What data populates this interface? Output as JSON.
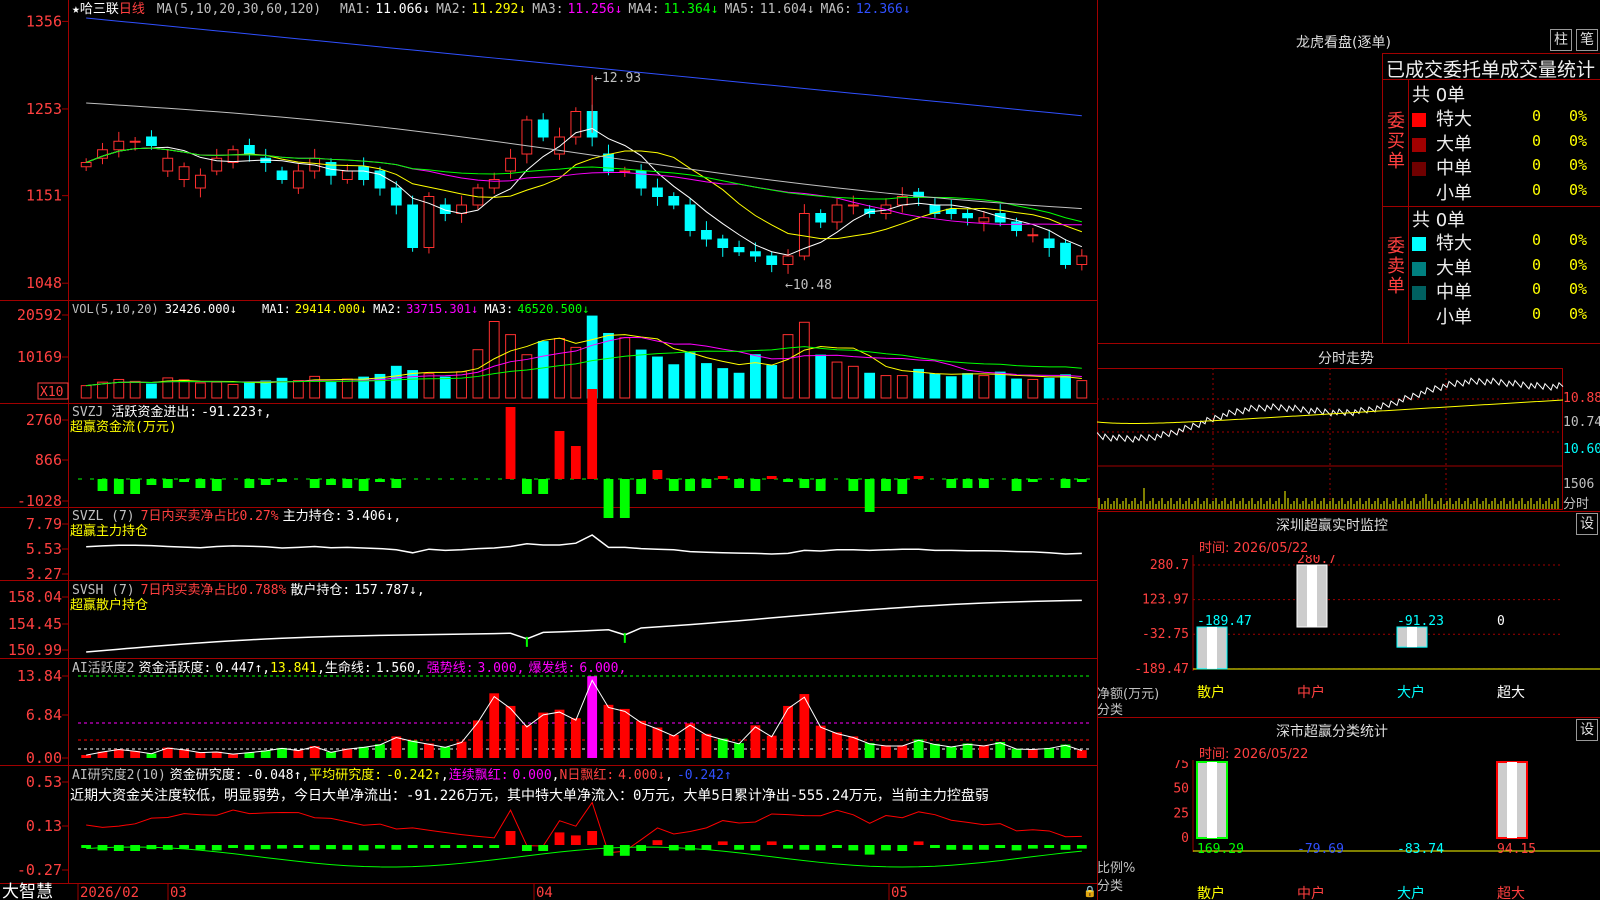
{
  "app": {
    "brand": "大智慧"
  },
  "main": {
    "star_icon": "star-icon",
    "stock_name": "哈三联",
    "period": "日线",
    "ma_label": "MA(5,10,20,30,60,120)",
    "ma": [
      {
        "label": "MA1:",
        "value": "11.066↓",
        "color": "#ffffff"
      },
      {
        "label": "MA2:",
        "value": "11.292↓",
        "color": "#ffff00"
      },
      {
        "label": "MA3:",
        "value": "11.256↓",
        "color": "#ff00ff"
      },
      {
        "label": "MA4:",
        "value": "11.364↓",
        "color": "#00ff00"
      },
      {
        "label": "MA5:",
        "value": "11.604↓",
        "color": "#c0c0c0"
      },
      {
        "label": "MA6:",
        "value": "12.366↓",
        "color": "#3050ff"
      }
    ],
    "y_ticks": [
      "1356",
      "1253",
      "1151",
      "1048"
    ],
    "high_label": "12.93",
    "low_label": "10.48"
  },
  "vol": {
    "title": "VOL(5,10,20)",
    "value": "32426.000↓",
    "ma": [
      {
        "label": "MA1:",
        "value": "29414.000↓",
        "color": "#ffff00"
      },
      {
        "label": "MA2:",
        "value": "33715.301↓",
        "color": "#ff00ff"
      },
      {
        "label": "MA3:",
        "value": "46520.500↓",
        "color": "#00ff00"
      }
    ],
    "y_ticks": [
      "20592",
      "10169"
    ],
    "unit": "X10"
  },
  "svzj": {
    "title": "SVZJ",
    "label": "活跃资金进出:",
    "value": "-91.223↑",
    "sep": ",",
    "subtitle": "超赢资金流(万元)",
    "y_ticks": [
      "2760",
      "866",
      "-1028"
    ]
  },
  "svzl": {
    "title": "SVZL (7)",
    "label1": "7日内买卖净占比0.27%",
    "label2": "主力持仓:",
    "value": "3.406↓",
    "sep": ",",
    "subtitle": "超赢主力持仓",
    "y_ticks": [
      "7.79",
      "5.53",
      "3.27"
    ]
  },
  "svsh": {
    "title": "SVSH (7)",
    "label1": "7日内买卖净占比0.788%",
    "label2": "散户持仓:",
    "value": "157.787↓",
    "sep": ",",
    "subtitle": "超赢散户持仓",
    "y_ticks": [
      "158.04",
      "154.45",
      "150.99"
    ]
  },
  "ai1": {
    "title": "AI活跃度2",
    "label1": "资金活跃度:",
    "value1": "0.447↑",
    "value2": "13.841",
    "label3": "生命线:",
    "value3": "1.560",
    "label4": "强势线:",
    "value4": "3.000",
    "label5": "爆发线:",
    "value5": "6.000",
    "y_ticks": [
      "13.84",
      "6.84",
      "0.00"
    ]
  },
  "ai2": {
    "title": "AI研究度2(10)",
    "label1": "资金研究度:",
    "value1": "-0.048↑",
    "label2": "平均研究度:",
    "value2": "-0.242↑",
    "label3": "连续飘红:",
    "value3": "0.000",
    "label4": "N日飘红:",
    "value4": "4.000↓",
    "value5": "-0.242↑",
    "comment": "近期大资金关注度较低，明显弱势，今日大单净流出：-91.226万元，其中特大单净流入：0万元，大单5日累计净出-555.24万元，当前主力控盘弱",
    "y_ticks": [
      "0.53",
      "0.13",
      "-0.27"
    ]
  },
  "xaxis": {
    "labels": [
      "2026/02",
      "03",
      "04",
      "05"
    ]
  },
  "right": {
    "lhb_title": "龙虎看盘(逐单)",
    "btn_zhu": "柱",
    "btn_bi": "笔",
    "stat_title": "已成交委托单成交量统计",
    "buy_label": [
      "委",
      "买",
      "单"
    ],
    "sell_label": [
      "委",
      "卖",
      "单"
    ],
    "buy_total": "共 0单",
    "sell_total": "共 0单",
    "buy_rows": [
      {
        "name": "特大",
        "count": "0",
        "pct": "0%",
        "color": "#ff0000"
      },
      {
        "name": "大单",
        "count": "0",
        "pct": "0%",
        "color": "#a00000"
      },
      {
        "name": "中单",
        "count": "0",
        "pct": "0%",
        "color": "#700000"
      },
      {
        "name": "小单",
        "count": "0",
        "pct": "0%",
        "color": "#000000"
      }
    ],
    "sell_rows": [
      {
        "name": "特大",
        "count": "0",
        "pct": "0%",
        "color": "#00ffff"
      },
      {
        "name": "大单",
        "count": "0",
        "pct": "0%",
        "color": "#008080"
      },
      {
        "name": "中单",
        "count": "0",
        "pct": "0%",
        "color": "#006060"
      },
      {
        "name": "小单",
        "count": "0",
        "pct": "0%",
        "color": "#000000"
      }
    ],
    "intraday_title": "分时走势",
    "intraday_prices": [
      "10.88",
      "10.74",
      "10.60"
    ],
    "intraday_vol": "1506",
    "intraday_unit": "分时",
    "monitor_title": "深圳超赢实时监控",
    "monitor_btn": "设",
    "monitor_time": "时间: 2026/05/22",
    "monitor_yticks": [
      "280.7",
      "123.97",
      "-32.75",
      "-189.47"
    ],
    "monitor_values": [
      "-189.47",
      "280.7",
      "-91.23",
      "0"
    ],
    "monitor_ylabel": "净额(万元)",
    "monitor_xlabel": "分类",
    "categories": [
      "散户",
      "中户",
      "大户",
      "超大"
    ],
    "class_title": "深市超赢分类统计",
    "class_btn": "设",
    "class_time": "时间: 2026/05/22",
    "class_yticks": [
      "75",
      "50",
      "25",
      "0"
    ],
    "class_values": [
      "169.29",
      "-79.69",
      "-83.74",
      "94.15"
    ],
    "class_ylabel": "比例%",
    "class_xlabel": "分类"
  },
  "chart_data": {
    "type": "candlestick",
    "dates_first": "2026/02",
    "close": [
      11.9,
      12.05,
      12.15,
      12.15,
      12.1,
      11.95,
      11.85,
      11.75,
      11.95,
      12.05,
      12.0,
      11.9,
      11.7,
      11.8,
      11.95,
      11.75,
      11.8,
      11.7,
      11.6,
      11.4,
      10.9,
      11.5,
      11.3,
      11.4,
      11.6,
      11.7,
      11.95,
      12.4,
      12.2,
      12.2,
      12.5,
      12.2,
      11.8,
      11.8,
      11.6,
      11.5,
      11.4,
      11.1,
      11.0,
      10.9,
      10.85,
      10.8,
      10.7,
      10.8,
      11.3,
      11.2,
      11.4,
      11.4,
      11.3,
      11.4,
      11.5,
      11.5,
      11.3,
      11.3,
      11.25,
      11.25,
      11.2,
      11.1,
      11.05,
      10.9,
      10.7,
      10.8
    ],
    "open": [
      11.85,
      11.95,
      12.05,
      12.15,
      12.2,
      11.8,
      11.7,
      11.6,
      11.8,
      11.9,
      12.1,
      11.95,
      11.8,
      11.6,
      11.8,
      11.9,
      11.7,
      11.85,
      11.8,
      11.6,
      11.4,
      10.9,
      11.4,
      11.3,
      11.4,
      11.6,
      11.8,
      12.0,
      12.4,
      12.0,
      12.2,
      12.5,
      12.0,
      11.8,
      11.8,
      11.6,
      11.5,
      11.4,
      11.1,
      11.0,
      10.9,
      10.85,
      10.8,
      10.7,
      10.8,
      11.3,
      11.2,
      11.4,
      11.35,
      11.3,
      11.4,
      11.55,
      11.4,
      11.35,
      11.3,
      11.2,
      11.3,
      11.2,
      11.05,
      11.0,
      10.95,
      10.7
    ],
    "volume": [
      3200,
      4100,
      4800,
      4300,
      3600,
      5200,
      4700,
      3900,
      4100,
      3500,
      3900,
      4400,
      5100,
      4500,
      5600,
      4000,
      4900,
      5400,
      6100,
      8200,
      7100,
      6300,
      5400,
      6800,
      12500,
      19800,
      16400,
      11200,
      14600,
      15400,
      13100,
      21200,
      16700,
      15600,
      12400,
      10600,
      8600,
      11700,
      8900,
      7600,
      6400,
      11200,
      8400,
      16400,
      19600,
      11100,
      9300,
      8200,
      6400,
      5800,
      5800,
      7400,
      6200,
      5500,
      6300,
      5800,
      6700,
      4900,
      4800,
      5100,
      6000,
      4500
    ],
    "net_flow": [
      0,
      -400,
      -500,
      -500,
      -200,
      -300,
      -100,
      -300,
      -400,
      0,
      -300,
      -200,
      -100,
      0,
      -300,
      -200,
      -300,
      -400,
      -100,
      -300,
      0,
      0,
      0,
      0,
      0,
      0,
      2400,
      -500,
      -500,
      1600,
      1100,
      3000,
      -1300,
      -1300,
      -500,
      300,
      -400,
      -400,
      -300,
      100,
      -300,
      -400,
      100,
      -100,
      -300,
      -400,
      0,
      -400,
      -1100,
      -400,
      -500,
      100,
      0,
      -300,
      -300,
      -300,
      0,
      -400,
      -100,
      0,
      -300,
      -100
    ],
    "y_range": [
      10.4,
      13.6
    ]
  }
}
